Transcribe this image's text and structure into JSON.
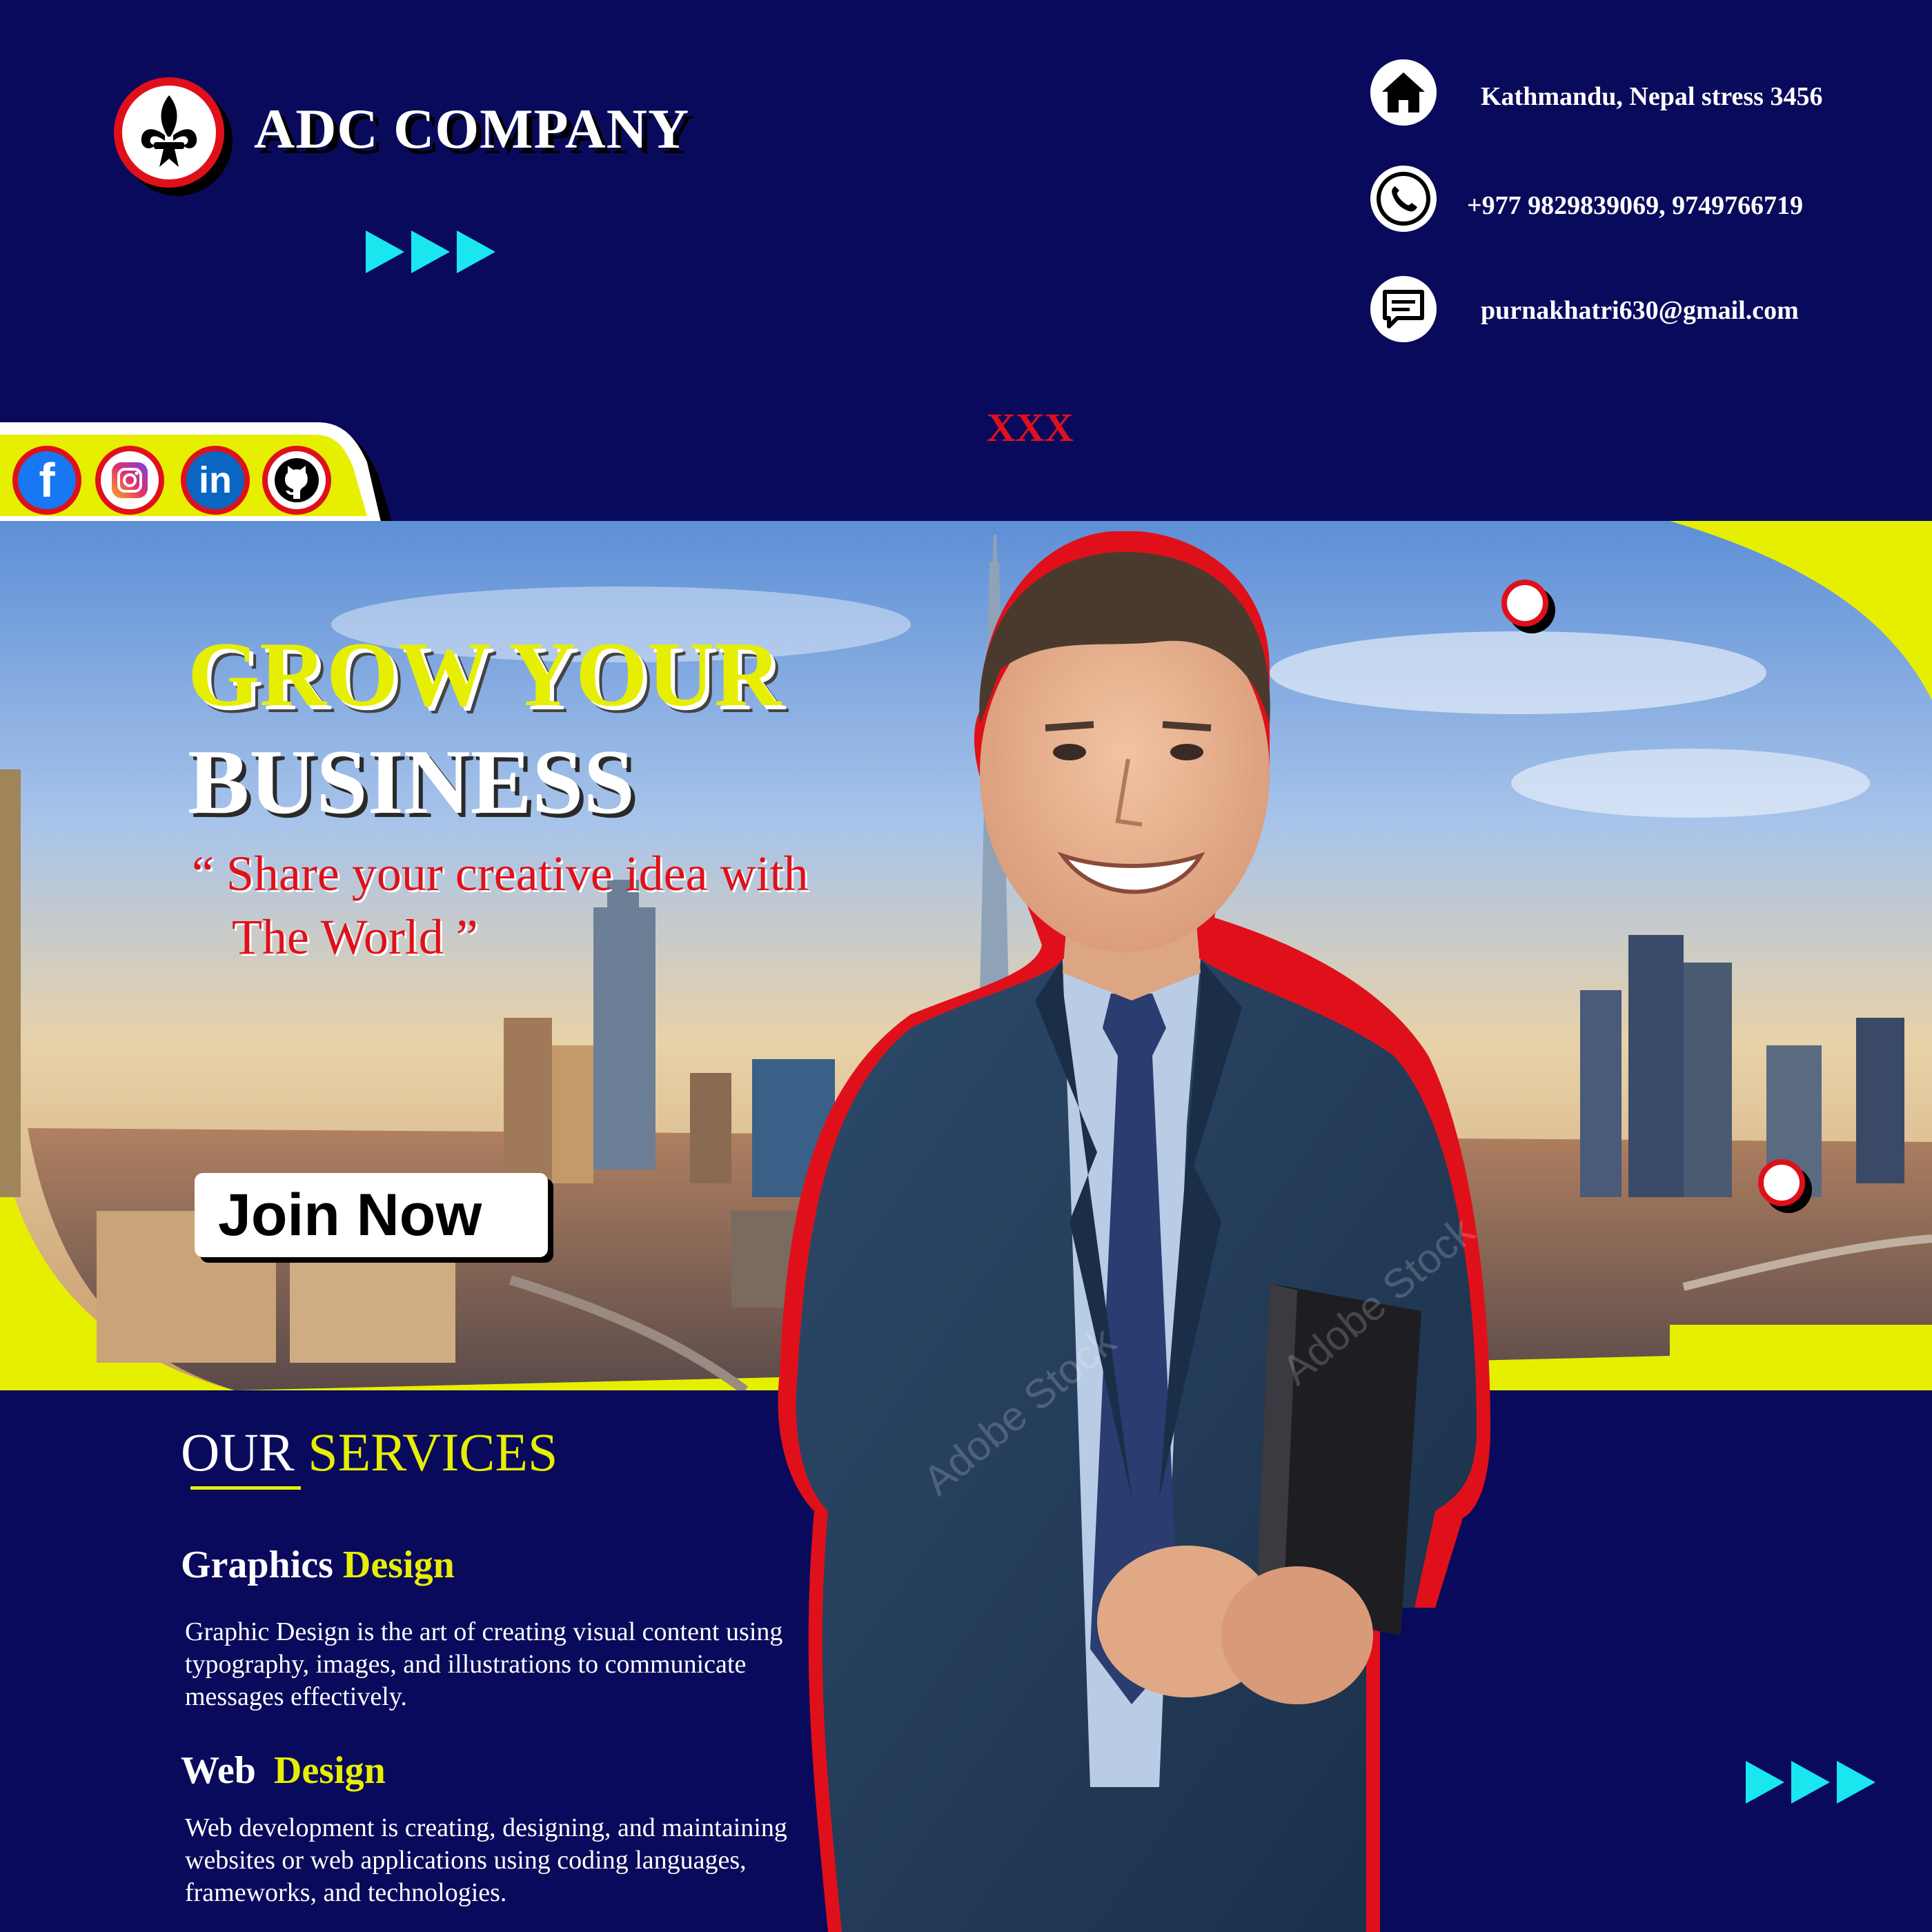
{
  "header": {
    "company_name": "ADC COMPANY",
    "contacts": [
      {
        "icon": "home-icon",
        "text": "Kathmandu, Nepal stress 3456"
      },
      {
        "icon": "phone-icon",
        "text": "+977 9829839069, 9749766719"
      },
      {
        "icon": "message-icon",
        "text": "purnakhatri630@gmail.com"
      }
    ],
    "marker": "XXX"
  },
  "social": [
    {
      "name": "facebook",
      "glyph": "f"
    },
    {
      "name": "instagram",
      "glyph": ""
    },
    {
      "name": "linkedin",
      "glyph": "in"
    },
    {
      "name": "github",
      "glyph": ""
    }
  ],
  "hero": {
    "headline_line1": "GROW YOUR",
    "headline_line2": "BUSINESS",
    "quote_line1": "“ Share your creative idea with",
    "quote_line2": "The World ”",
    "cta_label": "Join Now"
  },
  "services": {
    "title_part1": "OUR",
    "title_part2": "SERVICES",
    "items": [
      {
        "title_part1": "Graphics",
        "title_part2": "Design",
        "description": "Graphic Design is the art of creating visual content using typography, images, and illustrations to communicate messages effectively."
      },
      {
        "title_part1": "Web",
        "title_part2": "Design",
        "description": "Web development is creating, designing, and maintaining websites or web applications using coding languages, frameworks, and technologies."
      }
    ]
  },
  "colors": {
    "background": "#0a0a5c",
    "accent_yellow": "#e6ef00",
    "accent_red": "#e0101a",
    "accent_cyan": "#19e6ef"
  }
}
